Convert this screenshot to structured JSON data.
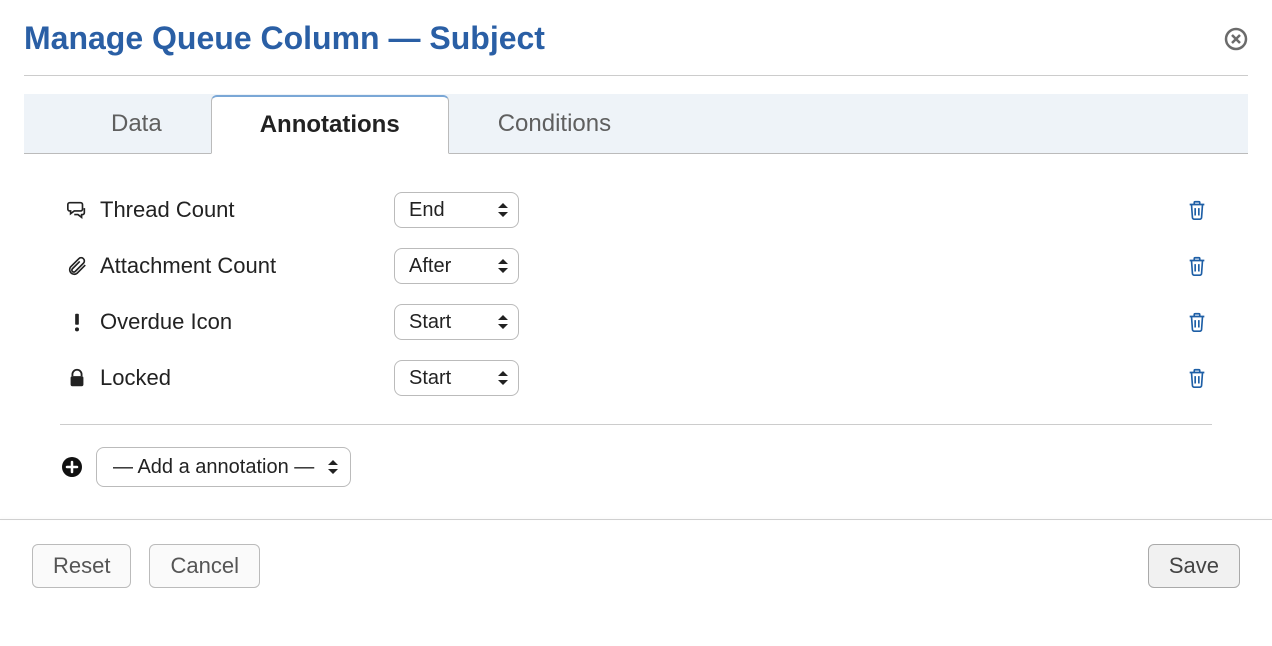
{
  "header": {
    "title": "Manage Queue Column — Subject"
  },
  "tabs": [
    {
      "label": "Data",
      "active": false
    },
    {
      "label": "Annotations",
      "active": true
    },
    {
      "label": "Conditions",
      "active": false
    }
  ],
  "annotations": [
    {
      "icon": "chat-icon",
      "label": "Thread Count",
      "position": "End"
    },
    {
      "icon": "paperclip-icon",
      "label": "Attachment Count",
      "position": "After"
    },
    {
      "icon": "exclamation-icon",
      "label": "Overdue Icon",
      "position": "Start"
    },
    {
      "icon": "lock-icon",
      "label": "Locked",
      "position": "Start"
    }
  ],
  "position_options": [
    "Start",
    "After",
    "End"
  ],
  "add_annotation": {
    "placeholder": "— Add a annotation —"
  },
  "footer": {
    "reset": "Reset",
    "cancel": "Cancel",
    "save": "Save"
  }
}
